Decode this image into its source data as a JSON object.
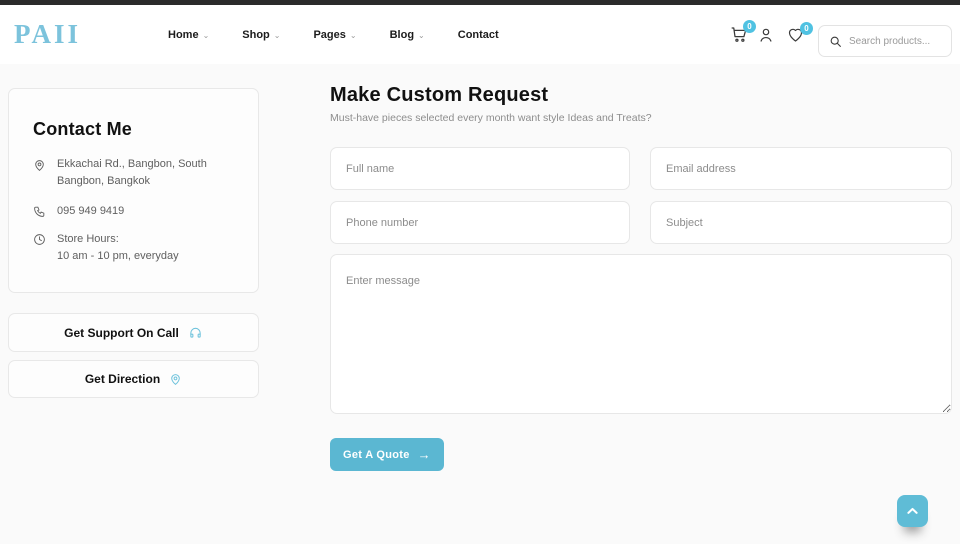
{
  "header": {
    "logo": "PAII",
    "nav": [
      {
        "label": "Home",
        "caret": "⌄"
      },
      {
        "label": "Shop",
        "caret": "⌄"
      },
      {
        "label": "Pages",
        "caret": "⌄"
      },
      {
        "label": "Blog",
        "caret": "⌄"
      },
      {
        "label": "Contact"
      }
    ],
    "cart_count": "0",
    "wishlist_count": "0",
    "search_placeholder": "Search products..."
  },
  "contact_card": {
    "title": "Contact Me",
    "address": "Ekkachai Rd., Bangbon, South Bangbon, Bangkok",
    "phone": "095 949 9419",
    "hours_label": "Store Hours:",
    "hours_value": "10 am - 10 pm, everyday"
  },
  "side_buttons": {
    "support_label": "Get Support On Call",
    "direction_label": "Get Direction"
  },
  "form": {
    "title": "Make Custom Request",
    "subtitle": "Must-have pieces selected every month want style Ideas and Treats?",
    "full_name_placeholder": "Full name",
    "email_placeholder": "Email address",
    "phone_placeholder": "Phone number",
    "subject_placeholder": "Subject",
    "message_placeholder": "Enter message",
    "submit_label": "Get A Quote",
    "submit_arrow": "→"
  },
  "colors": {
    "accent": "#5bb7d2",
    "badge": "#50c2e2",
    "logo_blue": "#7cc3dc",
    "topbar": "#2b2b2b"
  }
}
